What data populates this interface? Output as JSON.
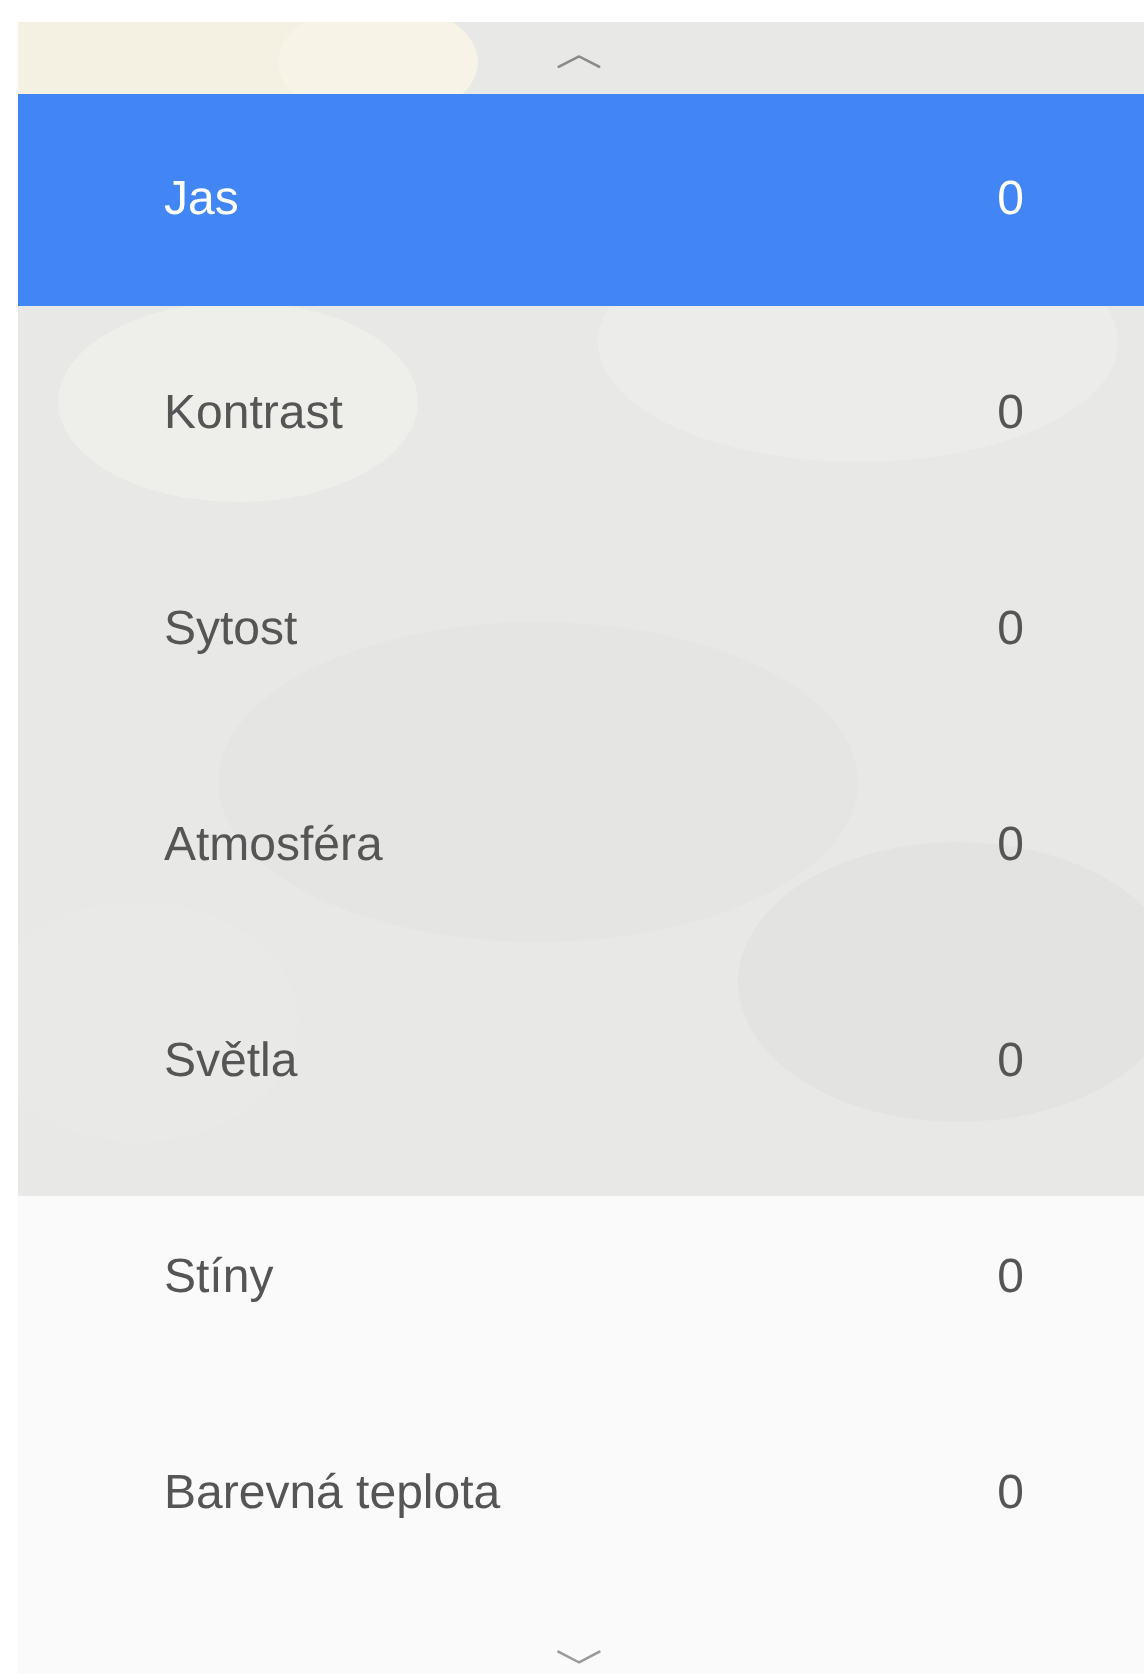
{
  "scroll_up": {
    "glyph": "︿"
  },
  "items": [
    {
      "label": "Jas",
      "value": "0",
      "selected": true
    },
    {
      "label": "Kontrast",
      "value": "0",
      "selected": false
    },
    {
      "label": "Sytost",
      "value": "0",
      "selected": false
    },
    {
      "label": "Atmosféra",
      "value": "0",
      "selected": false
    },
    {
      "label": "Světla",
      "value": "0",
      "selected": false
    },
    {
      "label": "Stíny",
      "value": "0",
      "selected": false
    },
    {
      "label": "Barevná teplota",
      "value": "0",
      "selected": false
    }
  ],
  "scroll_down": {
    "glyph": "﹀"
  }
}
